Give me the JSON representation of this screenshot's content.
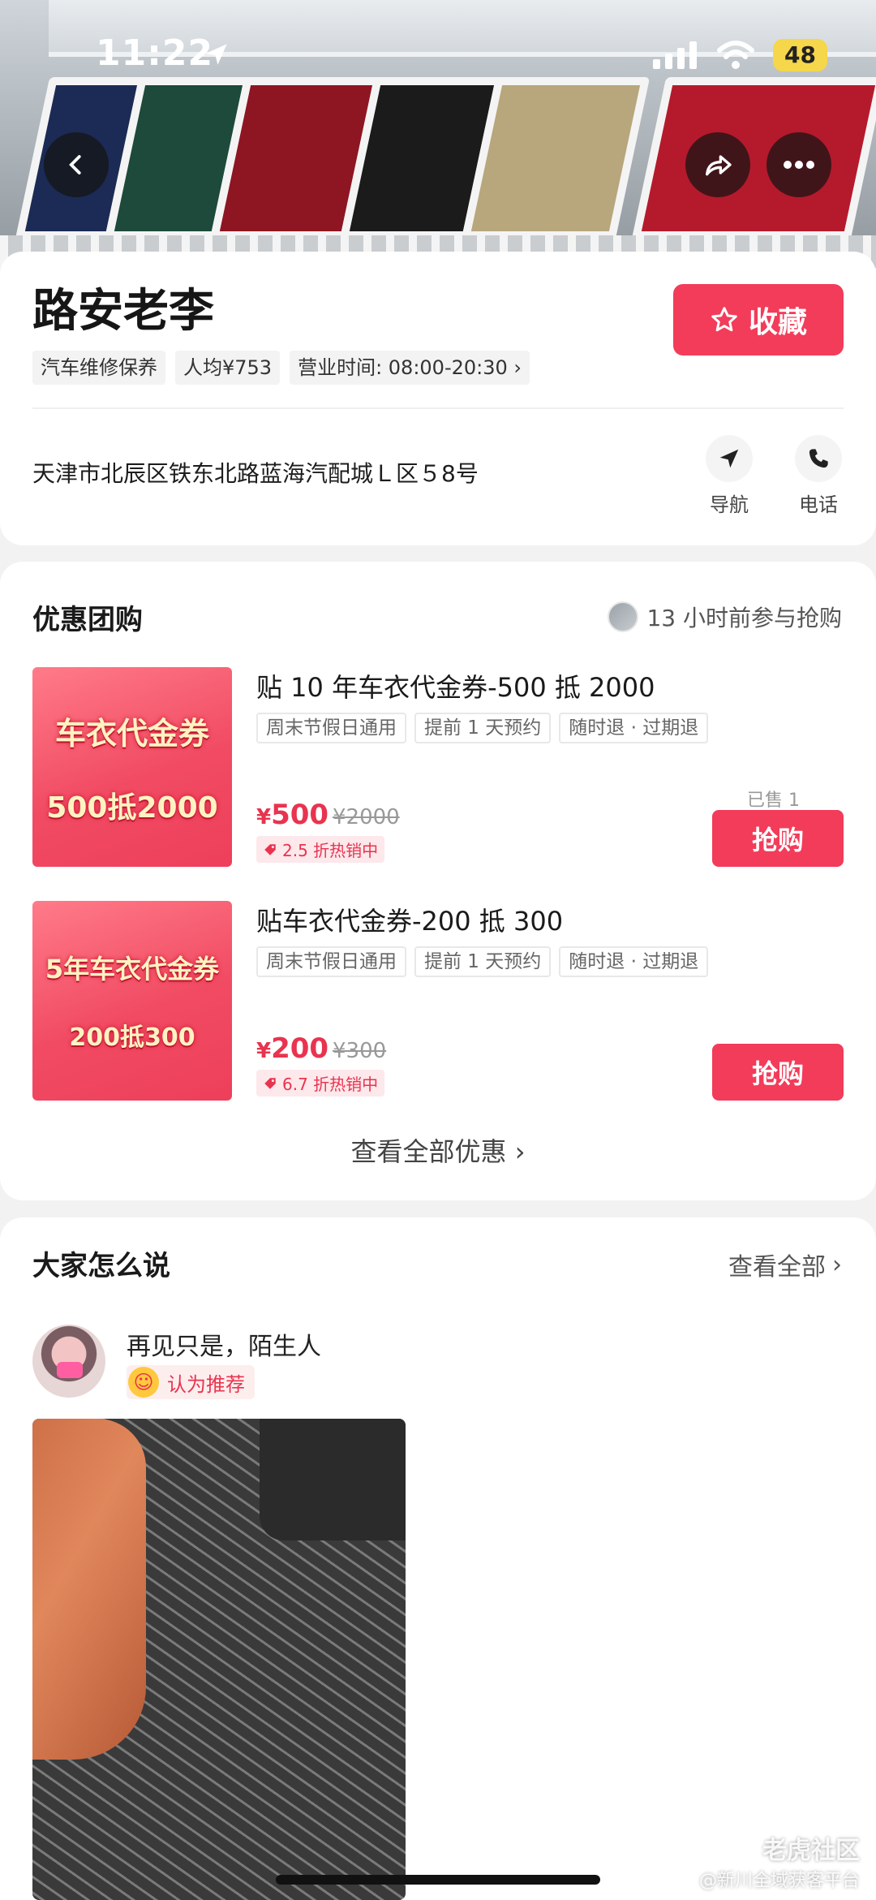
{
  "status_bar": {
    "time": "11:22",
    "battery": "48"
  },
  "shop": {
    "name": "路安老李",
    "favorite_label": "收藏",
    "tags": [
      "汽车维修保养",
      "人均¥753",
      "营业时间: 08:00-20:30"
    ],
    "address": "天津市北辰区铁东北路蓝海汽配城Ｌ区５8号",
    "nav_label": "导航",
    "phone_label": "电话"
  },
  "deals": {
    "title": "优惠团购",
    "meta": "13 小时前参与抢购",
    "items": [
      {
        "img_line1": "车衣代金券",
        "img_line2": "500抵2000",
        "title": "贴 10 年车衣代金券-500 抵 2000",
        "tags": [
          "周末节假日通用",
          "提前 1 天预约",
          "随时退 · 过期退"
        ],
        "price_symbol": "¥",
        "price": "500",
        "original_price": "¥2000",
        "discount": "2.5 折热销中",
        "sold": "已售 1",
        "buy_label": "抢购"
      },
      {
        "img_line1": "5年车衣代金券",
        "img_line2": "200抵300",
        "title": "贴车衣代金券-200 抵 300",
        "tags": [
          "周末节假日通用",
          "提前 1 天预约",
          "随时退 · 过期退"
        ],
        "price_symbol": "¥",
        "price": "200",
        "original_price": "¥300",
        "discount": "6.7 折热销中",
        "buy_label": "抢购"
      }
    ],
    "view_all": "查看全部优惠"
  },
  "reviews": {
    "title": "大家怎么说",
    "view_all": "查看全部",
    "items": [
      {
        "user": "再见只是，陌生人",
        "badge": "认为推荐"
      }
    ]
  },
  "watermark": {
    "line1": "老虎社区",
    "line2": "@新川全域获客平台"
  }
}
